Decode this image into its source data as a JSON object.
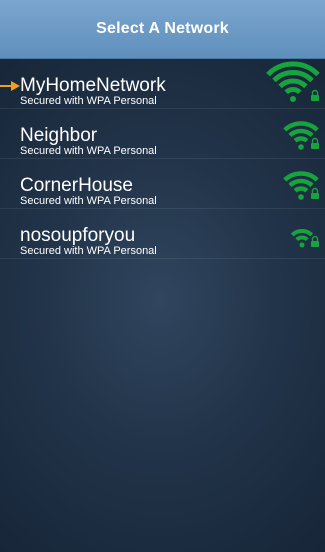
{
  "header": {
    "title": "Select A Network"
  },
  "networks": [
    {
      "name": "MyHomeNetwork",
      "security": "Secured with WPA Personal",
      "signal_bars": 4,
      "selected": true,
      "icon": "wifi-locked-icon"
    },
    {
      "name": "Neighbor",
      "security": "Secured with WPA Personal",
      "signal_bars": 3,
      "selected": false,
      "icon": "wifi-locked-icon"
    },
    {
      "name": "CornerHouse",
      "security": "Secured with WPA Personal",
      "signal_bars": 3,
      "selected": false,
      "icon": "wifi-locked-icon"
    },
    {
      "name": "nosoupforyou",
      "security": "Secured with WPA Personal",
      "signal_bars": 2,
      "selected": false,
      "icon": "wifi-locked-icon"
    }
  ],
  "colors": {
    "header_bg": "#6b98c4",
    "signal_green": "#17a43f",
    "selection_arrow": "#f0a020",
    "background": "#22344a"
  }
}
